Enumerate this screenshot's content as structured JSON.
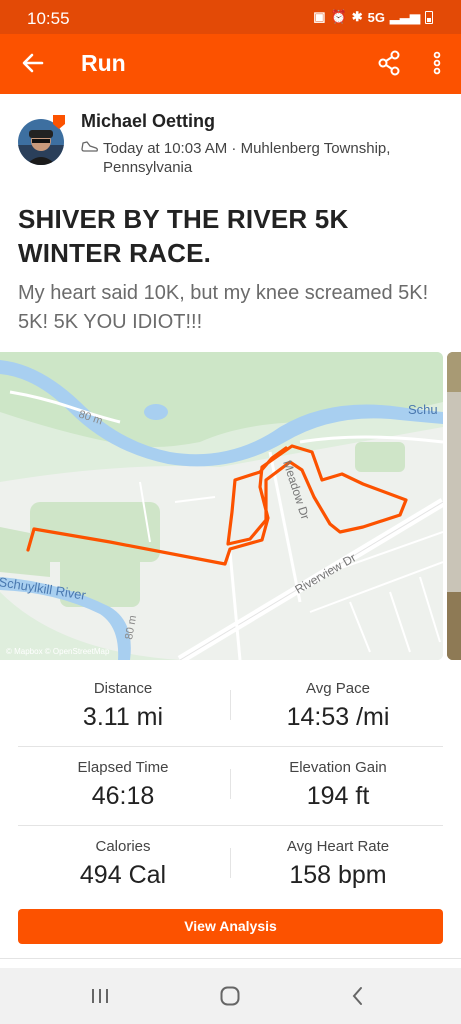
{
  "status_bar": {
    "time": "10:55",
    "network": "5G"
  },
  "app_bar": {
    "title": "Run",
    "back_icon": "arrow-left-icon",
    "share_icon": "share-icon",
    "more_icon": "more-vertical-icon",
    "color": "#fc5200"
  },
  "athlete": {
    "name": "Michael Oetting",
    "time": "Today at 10:03 AM",
    "location_line1": "Muhlenberg Township,",
    "location_line2": "Pennsylvania",
    "activity_icon": "shoe-icon"
  },
  "activity": {
    "title": "SHIVER BY THE RIVER 5K WINTER RACE.",
    "description": "My heart said 10K, but my knee screamed 5K! 5K! 5K YOU IDIOT!!!"
  },
  "map": {
    "attribution": "© Mapbox © OpenStreetMap",
    "labels": {
      "schuylkill_river_left": "Schuylkill River",
      "schuylkill_right": "Schu",
      "meadow_dr": "Meadow Dr",
      "riverview_dr": "Riverview Dr",
      "eighty_m_top": "80 m",
      "eighty_m_bottom": "80 m"
    },
    "route_color": "#fc5200"
  },
  "stats": [
    {
      "left_label": "Distance",
      "left_value": "3.11 mi",
      "right_label": "Avg Pace",
      "right_value": "14:53 /mi"
    },
    {
      "left_label": "Elapsed Time",
      "left_value": "46:18",
      "right_label": "Elevation Gain",
      "right_value": "194 ft"
    },
    {
      "left_label": "Calories",
      "left_value": "494 Cal",
      "right_label": "Avg Heart Rate",
      "right_value": "158 bpm"
    }
  ],
  "view_analysis": "View Analysis",
  "nav": {
    "recents_icon": "recents-icon",
    "home_icon": "home-icon",
    "back_icon": "back-chevron-icon"
  }
}
